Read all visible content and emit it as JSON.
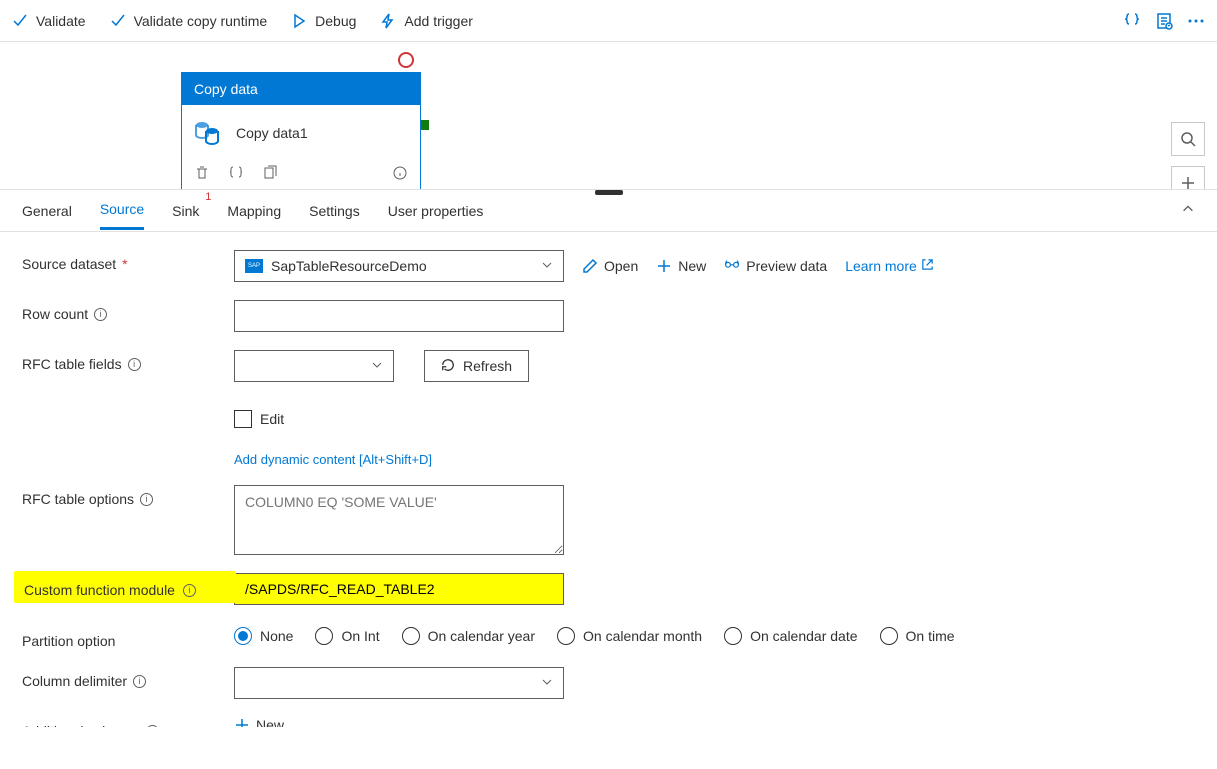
{
  "toolbar": {
    "validate": "Validate",
    "validate_copy": "Validate copy runtime",
    "debug": "Debug",
    "add_trigger": "Add trigger"
  },
  "activity": {
    "header": "Copy data",
    "name": "Copy data1"
  },
  "tabs": {
    "general": "General",
    "source": "Source",
    "sink": "Sink",
    "sink_badge": "1",
    "mapping": "Mapping",
    "settings": "Settings",
    "user_properties": "User properties"
  },
  "form": {
    "source_dataset_label": "Source dataset",
    "source_dataset_value": "SapTableResourceDemo",
    "open": "Open",
    "new": "New",
    "preview": "Preview data",
    "learn_more": "Learn more",
    "row_count_label": "Row count",
    "rfc_fields_label": "RFC table fields",
    "refresh": "Refresh",
    "edit": "Edit",
    "dynamic_content": "Add dynamic content [Alt+Shift+D]",
    "rfc_options_label": "RFC table options",
    "rfc_options_placeholder": "COLUMN0 EQ 'SOME VALUE'",
    "custom_fn_label": "Custom function module",
    "custom_fn_value": "/SAPDS/RFC_READ_TABLE2",
    "partition_label": "Partition option",
    "partition_options": {
      "none": "None",
      "on_int": "On Int",
      "on_cal_year": "On calendar year",
      "on_cal_month": "On calendar month",
      "on_cal_date": "On calendar date",
      "on_time": "On time"
    },
    "column_delim_label": "Column delimiter",
    "additional_cols_label": "Additional columns",
    "additional_new": "New"
  }
}
